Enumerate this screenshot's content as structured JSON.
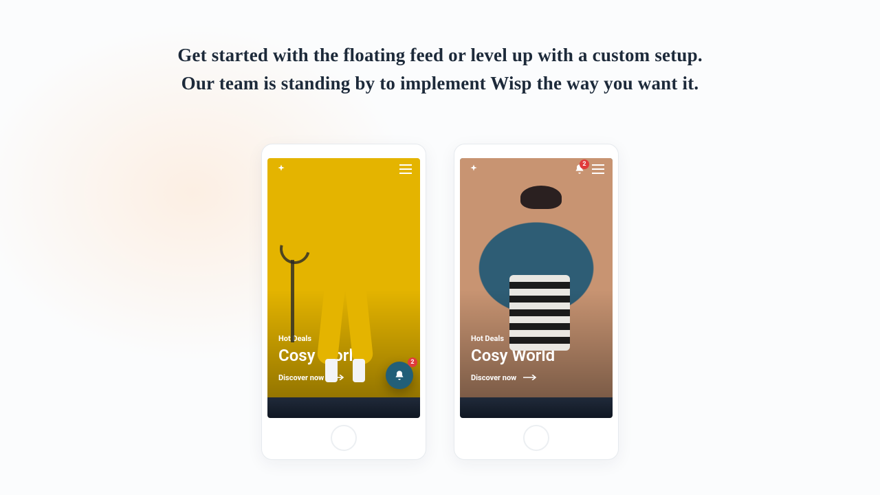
{
  "headline": {
    "line1": "Get started with the floating feed or level up with a custom setup.",
    "line2": "Our team is standing by to implement Wisp the way you want it."
  },
  "phones": [
    {
      "id": "floating-feed",
      "eyebrow": "Hot Deals",
      "title": "Cosy World",
      "cta": "Discover now",
      "notification_count": "2"
    },
    {
      "id": "custom-setup",
      "eyebrow": "Hot Deals",
      "title": "Cosy World",
      "cta": "Discover now",
      "notification_count": "2"
    }
  ],
  "colors": {
    "text": "#1d2a3a",
    "badge": "#e03b3b",
    "float_bell_bg": "#225f78"
  }
}
